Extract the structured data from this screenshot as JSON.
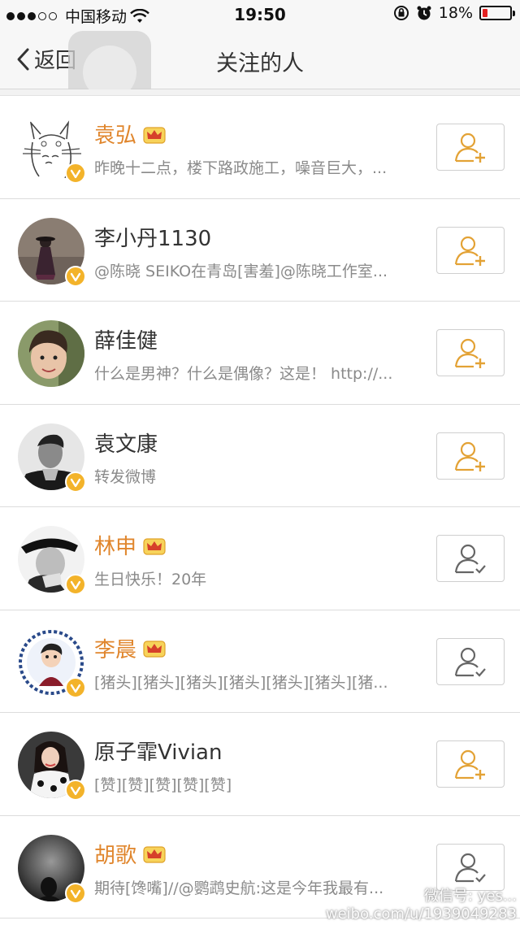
{
  "status_bar": {
    "carrier": "中国移动",
    "time": "19:50",
    "battery_percent": "18%",
    "battery_level": 0.18,
    "battery_color": "#e22222"
  },
  "nav": {
    "back_label": "返回",
    "title": "关注的人"
  },
  "accent_color": "#e0862d",
  "verified_color": "#f3b32a",
  "users": [
    {
      "name": "袁弘",
      "vip": true,
      "verified": true,
      "desc": "昨晚十二点，楼下路政施工，噪音巨大，...",
      "following": false,
      "avatar": "totoro-sketch"
    },
    {
      "name": "李小丹1130",
      "vip": false,
      "verified": true,
      "desc": "@陈晓 SEIKO在青岛[害羞]@陈晓工作室...",
      "following": false,
      "avatar": "photo-woman"
    },
    {
      "name": "薛佳健",
      "vip": false,
      "verified": false,
      "desc": "什么是男神？什么是偶像？这是！ http://...",
      "following": false,
      "avatar": "photo-man"
    },
    {
      "name": "袁文康",
      "vip": false,
      "verified": true,
      "desc": "转发微博",
      "following": false,
      "avatar": "photo-bw-man"
    },
    {
      "name": "林申",
      "vip": true,
      "verified": true,
      "desc": "生日快乐！20年",
      "following": true,
      "avatar": "photo-bw-man-hat"
    },
    {
      "name": "李晨",
      "vip": true,
      "verified": true,
      "desc": "[猪头][猪头][猪头][猪头][猪头][猪头][猪...",
      "following": true,
      "avatar": "cartoon-porcelain"
    },
    {
      "name": "原子霏Vivian",
      "vip": false,
      "verified": true,
      "desc": "[赞][赞][赞][赞][赞]",
      "following": false,
      "avatar": "photo-woman-dress"
    },
    {
      "name": "胡歌",
      "vip": true,
      "verified": true,
      "desc": "期待[馋嘴]//@鹦鹉史航:这是今年我最有...",
      "following": true,
      "avatar": "photo-dark"
    }
  ],
  "watermark": {
    "line1": "微信号: yes...",
    "line2": "weibo.com/u/1939049283"
  }
}
